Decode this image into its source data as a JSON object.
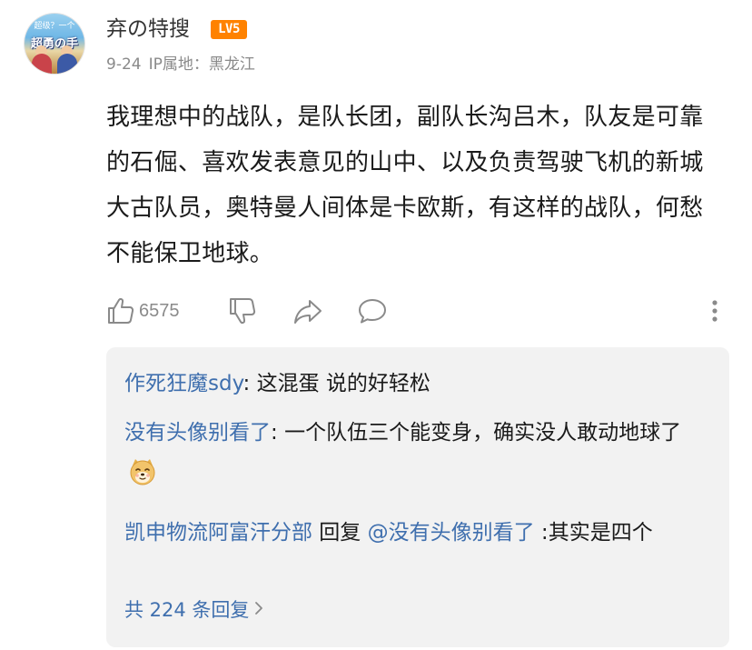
{
  "author": {
    "name": "弃の特搜",
    "level_badge": "LV5",
    "date": "9-24",
    "ip_location": "IP属地：黑龙江",
    "avatar_text_top": "超级？一个",
    "avatar_text_main": "超勇の手"
  },
  "comment": {
    "text": "我理想中的战队，是队长团，副队长沟吕木，队友是可靠的石倔、喜欢发表意见的山中、以及负责驾驶飞机的新城大古队员，奥特曼人间体是卡欧斯，有这样的战队，何愁不能保卫地球。"
  },
  "actions": {
    "like_icon": "thumbs-up-icon",
    "like_count": "6575",
    "dislike_icon": "thumbs-down-icon",
    "share_icon": "share-arrow-icon",
    "reply_icon": "speech-bubble-icon",
    "more_icon": "more-vertical-icon"
  },
  "replies": [
    {
      "nick": "作死狂魔sdy",
      "separator": ": ",
      "text": "这混蛋 说的好轻松"
    },
    {
      "nick": "没有头像别看了",
      "separator": ": ",
      "text": "一个队伍三个能变身，确实没人敢动地球了",
      "emoji": "doge-emoji"
    },
    {
      "nick": "凯申物流阿富汗分部",
      "reply_word": " 回复 ",
      "mention": "@没有头像别看了",
      "separator": " :",
      "text": "其实是四个"
    }
  ],
  "view_all": {
    "label": "共 224 条回复",
    "icon": "chevron-right-icon"
  },
  "colors": {
    "link_blue": "#3f6fae",
    "badge_orange": "#ff8200",
    "meta_gray": "#8a8a8a",
    "reply_bg": "#f2f2f2"
  }
}
